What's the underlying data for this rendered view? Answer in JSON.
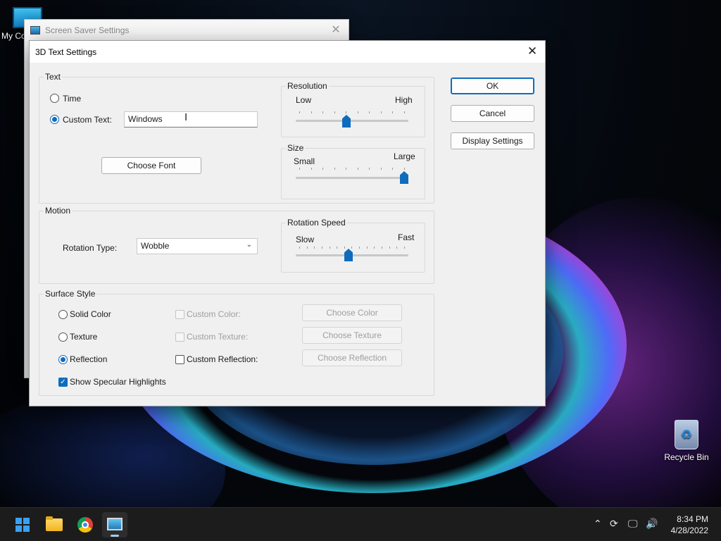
{
  "desktop": {
    "icons": {
      "my_computer": "My Co",
      "recycle_bin": "Recycle Bin"
    }
  },
  "background_window": {
    "title": "Screen Saver Settings"
  },
  "dialog": {
    "title": "3D Text Settings",
    "buttons": {
      "ok": "OK",
      "cancel": "Cancel",
      "display_settings": "Display Settings"
    },
    "text_group": {
      "label": "Text",
      "time_label": "Time",
      "custom_text_label": "Custom Text:",
      "custom_text_value": "Windows",
      "selected": "custom_text",
      "choose_font": "Choose Font"
    },
    "resolution": {
      "label": "Resolution",
      "min_label": "Low",
      "max_label": "High",
      "value_fraction": 0.45
    },
    "size": {
      "label": "Size",
      "min_label": "Small",
      "max_label": "Large",
      "value_fraction": 1.0
    },
    "motion_group": {
      "label": "Motion",
      "rotation_type_label": "Rotation Type:",
      "rotation_type_value": "Wobble"
    },
    "rotation_speed": {
      "label": "Rotation Speed",
      "min_label": "Slow",
      "max_label": "Fast",
      "value_fraction": 0.47
    },
    "surface_group": {
      "label": "Surface Style",
      "solid_color": "Solid Color",
      "texture": "Texture",
      "reflection": "Reflection",
      "selected": "reflection",
      "custom_color": "Custom Color:",
      "custom_texture": "Custom Texture:",
      "custom_reflection": "Custom Reflection:",
      "choose_color": "Choose Color",
      "choose_texture": "Choose Texture",
      "choose_reflection": "Choose Reflection",
      "show_specular": "Show Specular Highlights",
      "show_specular_checked": true
    }
  },
  "taskbar": {
    "time": "8:34 PM",
    "date": "4/28/2022"
  },
  "colors": {
    "accent": "#0f6cbd",
    "dialog_bg": "#f0f0f0",
    "taskbar_bg": "#1c1c1c"
  }
}
